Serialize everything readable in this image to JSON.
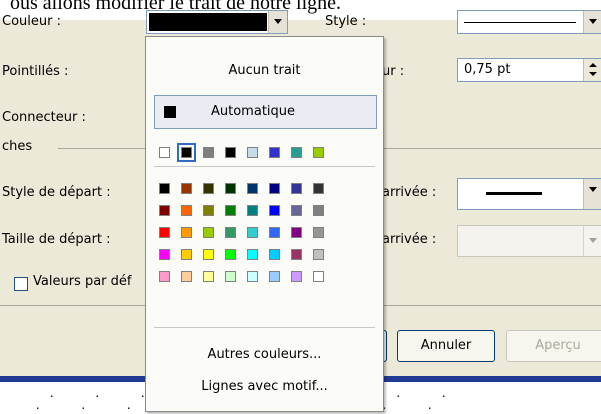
{
  "document": {
    "top_text": "ous allons modifier le trait de notre ligne.",
    "dots_row_1": ".            .            .            .                                                           .            .",
    "dots_row_2": ".            .            .            .                                                           .            ."
  },
  "dialog": {
    "color_label": "Couleur :",
    "color_value": "#000000",
    "style_label": "Style :",
    "dashes_label": "Pointillés :",
    "weight_label": "ur :",
    "weight_value": "0,75 pt",
    "connector_label": "Connecteur :",
    "section_label": "ches",
    "start_style_label": "Style de départ :",
    "end_style_label": "arrivée :",
    "start_size_label": "Taille de départ :",
    "end_size_label": "arrivée :",
    "defaults_label": "Valeurs par déf",
    "cancel_label": "Annuler",
    "preview_label": "Aperçu"
  },
  "palette": {
    "no_line_label": "Aucun trait",
    "auto_label": "Automatique",
    "recent_colors": [
      "#ffffff",
      "#000000",
      "#808080",
      "#000000",
      "#c8dce8",
      "#3333cc",
      "#2a9d8f",
      "#99cc00"
    ],
    "grid": [
      [
        "#000000",
        "#993300",
        "#333300",
        "#003300",
        "#003366",
        "#000080",
        "#333399",
        "#333333"
      ],
      [
        "#800000",
        "#ff6600",
        "#808000",
        "#008000",
        "#008080",
        "#0000ff",
        "#666699",
        "#808080"
      ],
      [
        "#ff0000",
        "#ff9900",
        "#99cc00",
        "#339966",
        "#33cccc",
        "#3366ff",
        "#800080",
        "#969696"
      ],
      [
        "#ff00ff",
        "#ffcc00",
        "#ffff00",
        "#00ff00",
        "#00ffff",
        "#00ccff",
        "#993366",
        "#c0c0c0"
      ],
      [
        "#ff99cc",
        "#ffcc99",
        "#ffff99",
        "#ccffcc",
        "#ccffff",
        "#99ccff",
        "#cc99ff",
        "#ffffff"
      ]
    ],
    "more_colors_label": "Autres couleurs...",
    "patterned_lines_label": "Lignes avec motif..."
  }
}
